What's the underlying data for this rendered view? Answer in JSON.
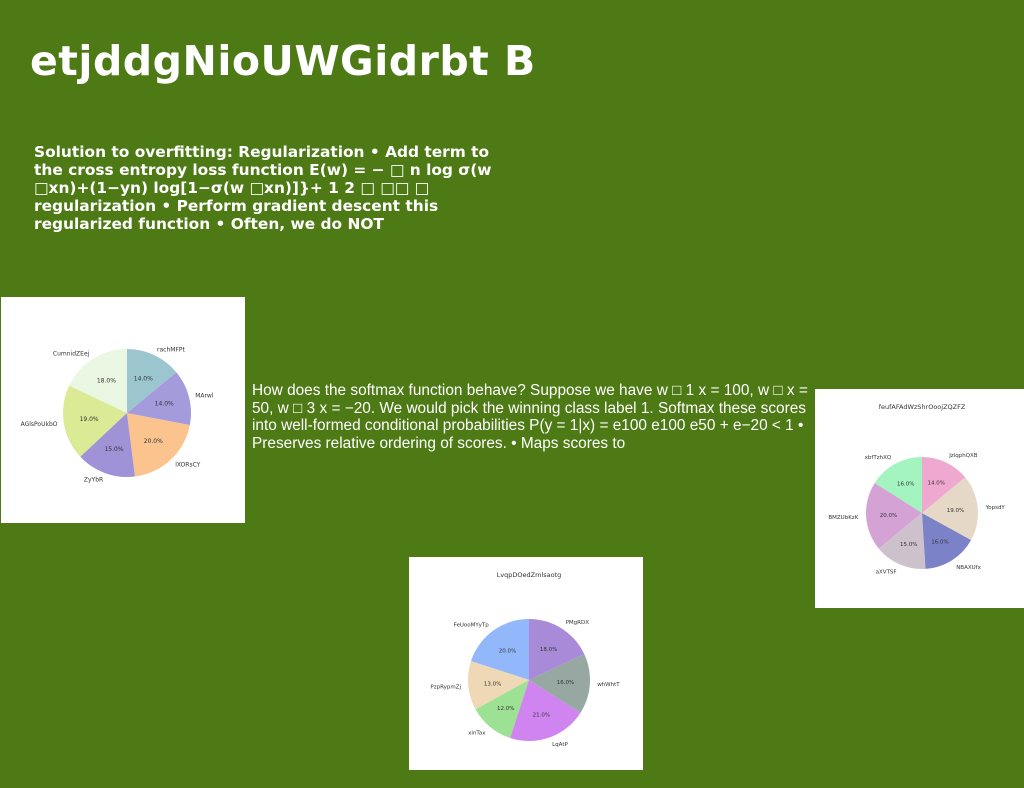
{
  "slide": {
    "title": "etjddgNioUWGidrbt B",
    "para1": "Solution to overfitting: Regularization • Add term to the cross entropy loss function E(w) = − □ n log σ(w □xn)+(1−yn) log[1−σ(w □xn)]}+ 1 2 □ □□ □ regularization • Perform gradient descent this regularized function • Often, we do NOT",
    "para2": "How does the softmax function behave? Suppose we have w □ 1 x = 100, w □ x = 50, w □ 3 x = −20. We would pick the winning class label 1. Softmax these scores into well-formed conditional probabilities P(y = 1|x) = e100 e100 e50 + e−20 < 1 • Preserves relative ordering of scores. • Maps scores to"
  },
  "chart_data": [
    {
      "type": "pie",
      "title": "",
      "categories": [
        "CumnidZEej",
        "AGlsPoUkbO",
        "ZyYbR",
        "lXORsCY",
        "MArwl",
        "rachMFPt"
      ],
      "values": [
        18.0,
        19.0,
        15.0,
        20.0,
        14.0,
        14.0
      ],
      "pct_labels": [
        "18.0%",
        "19.0%",
        "15.0%",
        "20.0%",
        "14.0%",
        "14.0%"
      ],
      "colors": [
        "#eaf7e2",
        "#dbea94",
        "#9f92d6",
        "#fbc48e",
        "#a39bdb",
        "#9cc6cf"
      ]
    },
    {
      "type": "pie",
      "title": "feufAFAdWzShrOoojZQZFZ",
      "categories": [
        "xbfTzhXQ",
        "BMZUbKzK",
        "aXVTSF",
        "NBAXUfx",
        "YopsdY",
        "JzlqphQXB"
      ],
      "values": [
        16.0,
        20.0,
        15.0,
        16.0,
        19.0,
        14.0
      ],
      "pct_labels": [
        "16.0%",
        "20.0%",
        "15.0%",
        "16.0%",
        "19.0%",
        "14.0%"
      ],
      "colors": [
        "#a4f4c0",
        "#d5a2d6",
        "#cdc2cc",
        "#7c82c7",
        "#e6d8c7",
        "#efa8d0"
      ]
    },
    {
      "type": "pie",
      "title": "LvqpDOedZmlsaotg",
      "categories": [
        "FeUooMYyTp",
        "PzpRypmZj",
        "xlnTax",
        "LqAtP",
        "whWhtT",
        "PMgRDX"
      ],
      "values": [
        20.0,
        13.0,
        12.0,
        21.0,
        16.0,
        18.0
      ],
      "pct_labels": [
        "20.0%",
        "13.0%",
        "12.0%",
        "21.0%",
        "16.0%",
        "18.0%"
      ],
      "colors": [
        "#93b7fb",
        "#eed8b6",
        "#9ce194",
        "#cf84ef",
        "#97a8a3",
        "#a98ad8"
      ]
    }
  ]
}
